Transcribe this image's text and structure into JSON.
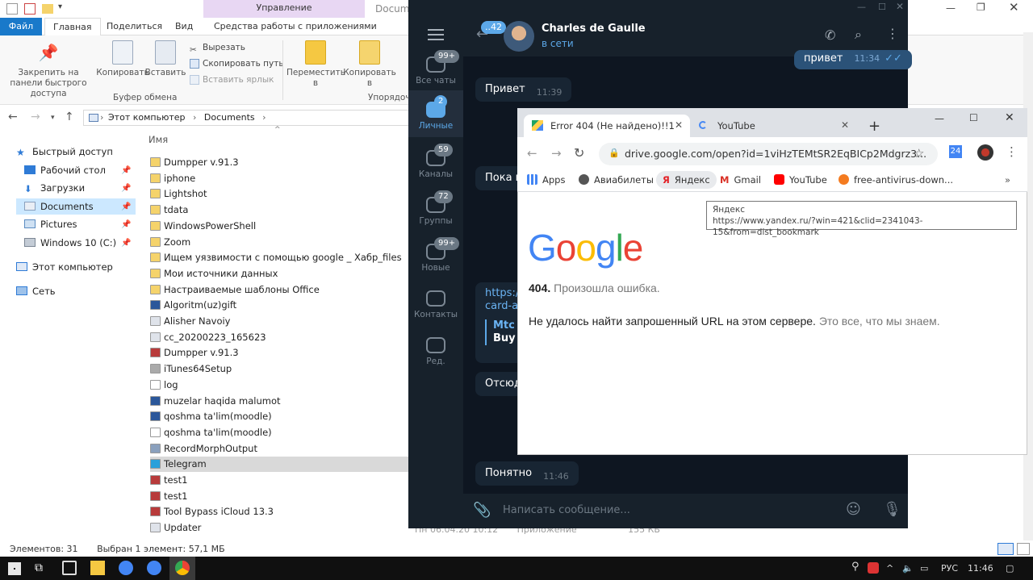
{
  "explorer": {
    "ribbon_context": "Управление",
    "window_title": "Documents",
    "tabs": [
      "Файл",
      "Главная",
      "Поделиться",
      "Вид",
      "Средства работы с приложениями"
    ],
    "ribbon": {
      "pin": "Закрепить на панели быстрого доступа",
      "copy": "Копировать",
      "paste": "Вставить",
      "cut": "Вырезать",
      "copy_path": "Скопировать путь",
      "paste_shortcut": "Вставить ярлык",
      "move_to": "Переместить в",
      "copy_to": "Копировать в",
      "group_clipboard": "Буфер обмена",
      "group_organize": "Упорядоч"
    },
    "address": [
      "Этот компьютер",
      "Documents"
    ],
    "nav": [
      "Быстрый доступ",
      "Рабочий стол",
      "Загрузки",
      "Documents",
      "Pictures",
      "Windows 10 (C:)",
      "Этот компьютер",
      "Сеть"
    ],
    "column_name": "Имя",
    "files": [
      "Dumpper v.91.3",
      "iphone",
      "Lightshot",
      "tdata",
      "WindowsPowerShell",
      "Zoom",
      "Ищем уязвимости с помощью google _ Хабр_files",
      "Мои источники данных",
      "Настраиваемые шаблоны Office",
      "Algoritm(uz)gift",
      "Alisher Navoiy",
      "cc_20200223_165623",
      "Dumpper v.91.3",
      "iTunes64Setup",
      "log",
      "muzelar haqida malumot",
      "qoshma ta'lim(moodle)",
      "qoshma ta'lim(moodle)",
      "RecordMorphOutput",
      "Telegram",
      "test1",
      "test1",
      "Tool Bypass iCloud 13.3",
      "Updater"
    ],
    "selected_file_index": 19,
    "partial_row": [
      "Пн 06.04.20 10:12",
      "Приложение",
      "155 КБ"
    ],
    "status_count": "Элементов: 31",
    "status_selected": "Выбран 1 элемент: 57,1 МБ"
  },
  "telegram": {
    "contact": "Charles de Gaulle",
    "status": "в сети",
    "back_badge": "42",
    "folders": [
      {
        "label": "Все чаты",
        "badge": "99+"
      },
      {
        "label": "Личные",
        "badge": "2"
      },
      {
        "label": "Каналы",
        "badge": "59"
      },
      {
        "label": "Группы",
        "badge": "72"
      },
      {
        "label": "Новые",
        "badge": "99+"
      },
      {
        "label": "Контакты",
        "badge": ""
      },
      {
        "label": "Ред.",
        "badge": ""
      }
    ],
    "messages": [
      {
        "text": "привет",
        "time": "11:34",
        "out": true
      },
      {
        "text": "Привет",
        "time": "11:39",
        "out": false
      },
      {
        "text": "Пока н",
        "time": "",
        "out": false
      },
      {
        "text": "https://",
        "time": "",
        "out": false
      },
      {
        "text": "Отсюда",
        "time": "",
        "out": false
      },
      {
        "text": "Понятно",
        "time": "11:46",
        "out": false
      }
    ],
    "link_line2": "card-ar",
    "preview_title": "Mtc G",
    "preview_text": "Buy M",
    "input_placeholder": "Написать сообщение..."
  },
  "chrome": {
    "tab1_title": "Error 404 (Не найдено)!!1",
    "tab2_title": "YouTube",
    "url": "drive.google.com/open?id=1viHzTEMtSR2EqBICp2Mdgrz3...",
    "ext_badge": "24",
    "bookmarks": [
      "Apps",
      "Авиабилеты",
      "Яндекс",
      "Gmail",
      "YouTube",
      "free-antivirus-down..."
    ],
    "tooltip_title": "Яндекс",
    "tooltip_url": "https://www.yandex.ru/?win=421&clid=2341043-15&from=dist_bookmark",
    "error_code": "404.",
    "error_short": "Произошла ошибка.",
    "error_main": "Не удалось найти запрошенный URL на этом сервере.",
    "error_tail": "Это все, что мы знаем.",
    "logo_text": "Google"
  },
  "taskbar": {
    "lang": "РУС",
    "time": "11:46"
  }
}
